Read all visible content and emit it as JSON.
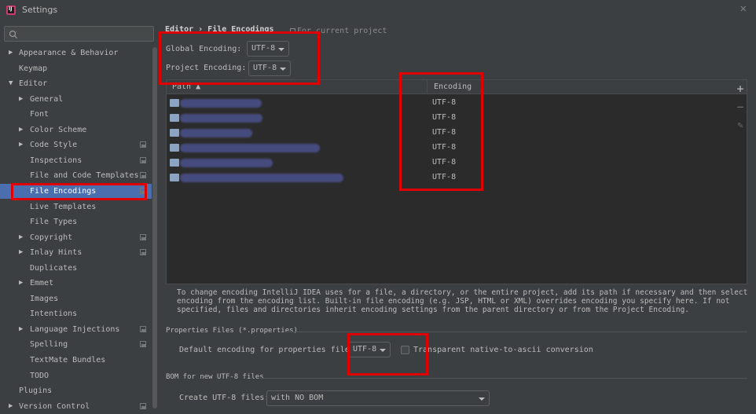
{
  "window": {
    "title": "Settings",
    "app_icon_text": "IJ"
  },
  "search": {
    "placeholder": ""
  },
  "sidebar": {
    "items": [
      {
        "label": "Appearance & Behavior",
        "arrow": "▶",
        "indent": 0,
        "project_icon": false
      },
      {
        "label": "Keymap",
        "arrow": "",
        "indent": 0,
        "project_icon": false
      },
      {
        "label": "Editor",
        "arrow": "▼",
        "indent": 0,
        "project_icon": false
      },
      {
        "label": "General",
        "arrow": "▶",
        "indent": 1,
        "project_icon": false
      },
      {
        "label": "Font",
        "arrow": "",
        "indent": 1,
        "project_icon": false
      },
      {
        "label": "Color Scheme",
        "arrow": "▶",
        "indent": 1,
        "project_icon": false
      },
      {
        "label": "Code Style",
        "arrow": "▶",
        "indent": 1,
        "project_icon": true
      },
      {
        "label": "Inspections",
        "arrow": "",
        "indent": 1,
        "project_icon": true
      },
      {
        "label": "File and Code Templates",
        "arrow": "",
        "indent": 1,
        "project_icon": true
      },
      {
        "label": "File Encodings",
        "arrow": "",
        "indent": 1,
        "project_icon": true,
        "selected": true
      },
      {
        "label": "Live Templates",
        "arrow": "",
        "indent": 1,
        "project_icon": false
      },
      {
        "label": "File Types",
        "arrow": "",
        "indent": 1,
        "project_icon": false
      },
      {
        "label": "Copyright",
        "arrow": "▶",
        "indent": 1,
        "project_icon": true
      },
      {
        "label": "Inlay Hints",
        "arrow": "▶",
        "indent": 1,
        "project_icon": true
      },
      {
        "label": "Duplicates",
        "arrow": "",
        "indent": 1,
        "project_icon": false
      },
      {
        "label": "Emmet",
        "arrow": "▶",
        "indent": 1,
        "project_icon": false
      },
      {
        "label": "Images",
        "arrow": "",
        "indent": 1,
        "project_icon": false
      },
      {
        "label": "Intentions",
        "arrow": "",
        "indent": 1,
        "project_icon": false
      },
      {
        "label": "Language Injections",
        "arrow": "▶",
        "indent": 1,
        "project_icon": true
      },
      {
        "label": "Spelling",
        "arrow": "",
        "indent": 1,
        "project_icon": true
      },
      {
        "label": "TextMate Bundles",
        "arrow": "",
        "indent": 1,
        "project_icon": false
      },
      {
        "label": "TODO",
        "arrow": "",
        "indent": 1,
        "project_icon": false
      },
      {
        "label": "Plugins",
        "arrow": "",
        "indent": 0,
        "project_icon": false
      },
      {
        "label": "Version Control",
        "arrow": "▶",
        "indent": 0,
        "project_icon": true
      }
    ]
  },
  "header": {
    "breadcrumb": "Editor › File Encodings",
    "scope_note": "For current project"
  },
  "encodings": {
    "global_label": "Global Encoding:",
    "global_value": "UTF-8",
    "project_label": "Project Encoding:",
    "project_value": "UTF-8"
  },
  "table": {
    "col_path": "Path ▲",
    "col_encoding": "Encoding",
    "rows": [
      {
        "encoding": "UTF-8"
      },
      {
        "encoding": "UTF-8"
      },
      {
        "encoding": "UTF-8"
      },
      {
        "encoding": "UTF-8"
      },
      {
        "encoding": "UTF-8"
      },
      {
        "encoding": "UTF-8"
      }
    ]
  },
  "toolbar": {
    "add": "+",
    "remove": "−",
    "edit": "✎"
  },
  "description": "To change encoding IntelliJ IDEA uses for a file, a directory, or the entire project, add its path if necessary and then select encoding from the encoding list. Built-in file encoding (e.g. JSP, HTML or XML) overrides encoding you specify here. If not specified, files and directories inherit encoding settings from the parent directory or from the Project Encoding.",
  "properties": {
    "section_title": "Properties Files (*.properties)",
    "default_label": "Default encoding for properties files:",
    "default_value": "UTF-8",
    "transparent_label": "Transparent native-to-ascii conversion",
    "transparent_checked": false
  },
  "bom": {
    "section_title": "BOM for new UTF-8 files",
    "create_label": "Create UTF-8 files:",
    "create_value": "with NO BOM"
  },
  "colors": {
    "background": "#3c3f41",
    "selection": "#4b6eaf",
    "table_bg": "#2b2b2b",
    "highlight": "#e00000"
  }
}
